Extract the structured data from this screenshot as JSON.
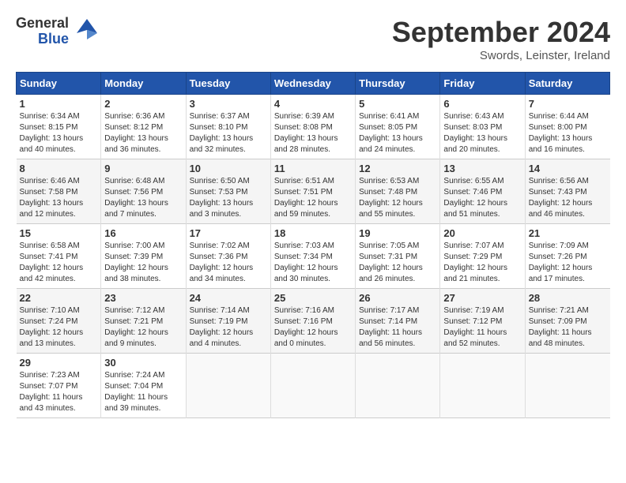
{
  "logo": {
    "general": "General",
    "blue": "Blue"
  },
  "title": "September 2024",
  "subtitle": "Swords, Leinster, Ireland",
  "days_header": [
    "Sunday",
    "Monday",
    "Tuesday",
    "Wednesday",
    "Thursday",
    "Friday",
    "Saturday"
  ],
  "weeks": [
    [
      {
        "day": "1",
        "info": "Sunrise: 6:34 AM\nSunset: 8:15 PM\nDaylight: 13 hours\nand 40 minutes."
      },
      {
        "day": "2",
        "info": "Sunrise: 6:36 AM\nSunset: 8:12 PM\nDaylight: 13 hours\nand 36 minutes."
      },
      {
        "day": "3",
        "info": "Sunrise: 6:37 AM\nSunset: 8:10 PM\nDaylight: 13 hours\nand 32 minutes."
      },
      {
        "day": "4",
        "info": "Sunrise: 6:39 AM\nSunset: 8:08 PM\nDaylight: 13 hours\nand 28 minutes."
      },
      {
        "day": "5",
        "info": "Sunrise: 6:41 AM\nSunset: 8:05 PM\nDaylight: 13 hours\nand 24 minutes."
      },
      {
        "day": "6",
        "info": "Sunrise: 6:43 AM\nSunset: 8:03 PM\nDaylight: 13 hours\nand 20 minutes."
      },
      {
        "day": "7",
        "info": "Sunrise: 6:44 AM\nSunset: 8:00 PM\nDaylight: 13 hours\nand 16 minutes."
      }
    ],
    [
      {
        "day": "8",
        "info": "Sunrise: 6:46 AM\nSunset: 7:58 PM\nDaylight: 13 hours\nand 12 minutes."
      },
      {
        "day": "9",
        "info": "Sunrise: 6:48 AM\nSunset: 7:56 PM\nDaylight: 13 hours\nand 7 minutes."
      },
      {
        "day": "10",
        "info": "Sunrise: 6:50 AM\nSunset: 7:53 PM\nDaylight: 13 hours\nand 3 minutes."
      },
      {
        "day": "11",
        "info": "Sunrise: 6:51 AM\nSunset: 7:51 PM\nDaylight: 12 hours\nand 59 minutes."
      },
      {
        "day": "12",
        "info": "Sunrise: 6:53 AM\nSunset: 7:48 PM\nDaylight: 12 hours\nand 55 minutes."
      },
      {
        "day": "13",
        "info": "Sunrise: 6:55 AM\nSunset: 7:46 PM\nDaylight: 12 hours\nand 51 minutes."
      },
      {
        "day": "14",
        "info": "Sunrise: 6:56 AM\nSunset: 7:43 PM\nDaylight: 12 hours\nand 46 minutes."
      }
    ],
    [
      {
        "day": "15",
        "info": "Sunrise: 6:58 AM\nSunset: 7:41 PM\nDaylight: 12 hours\nand 42 minutes."
      },
      {
        "day": "16",
        "info": "Sunrise: 7:00 AM\nSunset: 7:39 PM\nDaylight: 12 hours\nand 38 minutes."
      },
      {
        "day": "17",
        "info": "Sunrise: 7:02 AM\nSunset: 7:36 PM\nDaylight: 12 hours\nand 34 minutes."
      },
      {
        "day": "18",
        "info": "Sunrise: 7:03 AM\nSunset: 7:34 PM\nDaylight: 12 hours\nand 30 minutes."
      },
      {
        "day": "19",
        "info": "Sunrise: 7:05 AM\nSunset: 7:31 PM\nDaylight: 12 hours\nand 26 minutes."
      },
      {
        "day": "20",
        "info": "Sunrise: 7:07 AM\nSunset: 7:29 PM\nDaylight: 12 hours\nand 21 minutes."
      },
      {
        "day": "21",
        "info": "Sunrise: 7:09 AM\nSunset: 7:26 PM\nDaylight: 12 hours\nand 17 minutes."
      }
    ],
    [
      {
        "day": "22",
        "info": "Sunrise: 7:10 AM\nSunset: 7:24 PM\nDaylight: 12 hours\nand 13 minutes."
      },
      {
        "day": "23",
        "info": "Sunrise: 7:12 AM\nSunset: 7:21 PM\nDaylight: 12 hours\nand 9 minutes."
      },
      {
        "day": "24",
        "info": "Sunrise: 7:14 AM\nSunset: 7:19 PM\nDaylight: 12 hours\nand 4 minutes."
      },
      {
        "day": "25",
        "info": "Sunrise: 7:16 AM\nSunset: 7:16 PM\nDaylight: 12 hours\nand 0 minutes."
      },
      {
        "day": "26",
        "info": "Sunrise: 7:17 AM\nSunset: 7:14 PM\nDaylight: 11 hours\nand 56 minutes."
      },
      {
        "day": "27",
        "info": "Sunrise: 7:19 AM\nSunset: 7:12 PM\nDaylight: 11 hours\nand 52 minutes."
      },
      {
        "day": "28",
        "info": "Sunrise: 7:21 AM\nSunset: 7:09 PM\nDaylight: 11 hours\nand 48 minutes."
      }
    ],
    [
      {
        "day": "29",
        "info": "Sunrise: 7:23 AM\nSunset: 7:07 PM\nDaylight: 11 hours\nand 43 minutes."
      },
      {
        "day": "30",
        "info": "Sunrise: 7:24 AM\nSunset: 7:04 PM\nDaylight: 11 hours\nand 39 minutes."
      },
      {
        "day": "",
        "info": ""
      },
      {
        "day": "",
        "info": ""
      },
      {
        "day": "",
        "info": ""
      },
      {
        "day": "",
        "info": ""
      },
      {
        "day": "",
        "info": ""
      }
    ]
  ]
}
